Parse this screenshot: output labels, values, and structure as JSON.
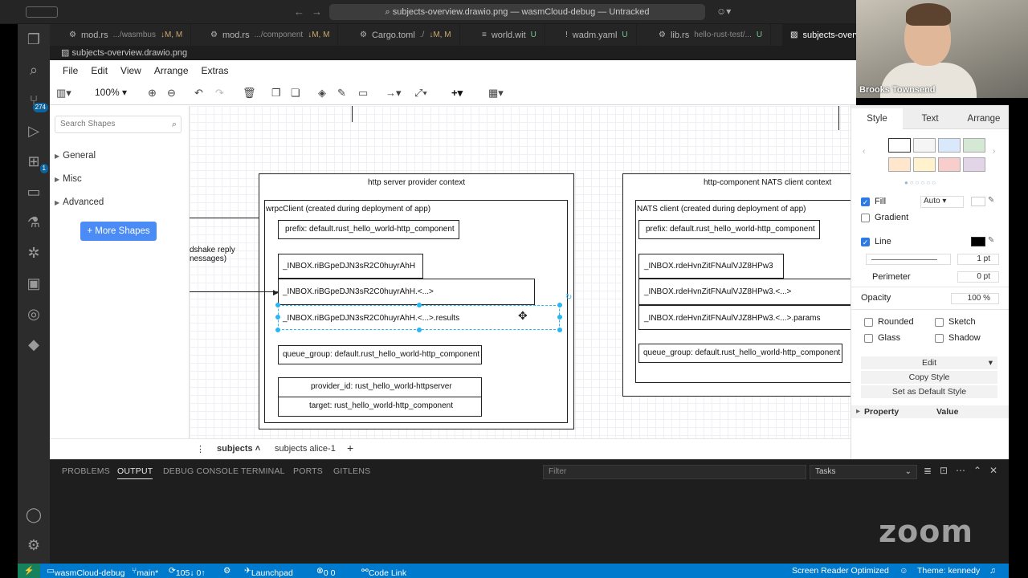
{
  "titlebar": {
    "command_center": "subjects-overview.drawio.png — wasmCloud-debug — Untracked"
  },
  "activity_badges": {
    "source_control": "274",
    "extensions": "1"
  },
  "tabs": [
    {
      "icon": "rust-icon",
      "name": "mod.rs",
      "path": ".../wasmbus",
      "status": "↓M, M"
    },
    {
      "icon": "rust-icon",
      "name": "mod.rs",
      "path": ".../component",
      "status": "↓M, M"
    },
    {
      "icon": "gear-icon",
      "name": "Cargo.toml",
      "path": "./",
      "status": "↓M, M"
    },
    {
      "icon": "file-icon",
      "name": "world.wit",
      "path": "",
      "status": "U"
    },
    {
      "icon": "exclamation-icon",
      "name": "wadm.yaml",
      "path": "",
      "status": "U"
    },
    {
      "icon": "rust-icon",
      "name": "lib.rs",
      "path": "hello-rust-test/...",
      "status": "U"
    },
    {
      "icon": "image-icon",
      "name": "subjects-overv",
      "path": "",
      "status": ""
    }
  ],
  "breadcrumb": "subjects-overview.drawio.png",
  "drawio": {
    "menu": [
      "File",
      "Edit",
      "View",
      "Arrange",
      "Extras"
    ],
    "zoom": "100%",
    "search_placeholder": "Search Shapes",
    "palettes": [
      "General",
      "Misc",
      "Advanced"
    ],
    "more_shapes": "More Shapes",
    "diagram": {
      "left_context_title": "http server provider context",
      "left_client_title": "wrpcClient (created during deployment of app)",
      "left_prefix": "prefix: default.rust_hello_world-http_component",
      "left_inbox": "_INBOX.riBGpeDJN3sR2C0huyrAhH",
      "left_inbox_wild": "_INBOX.riBGpeDJN3sR2C0huyrAhH.<...>",
      "left_inbox_results": "_INBOX.riBGpeDJN3sR2C0huyrAhH.<...>.results",
      "left_queue_group": "queue_group: default.rust_hello_world-http_component",
      "left_provider_id": "provider_id: rust_hello_world-httpserver",
      "left_target": "target: rust_hello_world-http_component",
      "handshake_line1": "dshake reply",
      "handshake_line2": "nessages)",
      "right_context_title": "http-component NATS client context",
      "right_client_title": "NATS client (created during deployment of app)",
      "right_prefix": "prefix: default.rust_hello_world-http_component",
      "right_inbox": "_INBOX.rdeHvnZitFNAulVJZ8HPw3",
      "right_inbox_wild": "_INBOX.rdeHvnZitFNAulVJZ8HPw3.<...>",
      "right_inbox_params": "_INBOX.rdeHvnZitFNAulVJZ8HPw3.<...>.params",
      "right_queue_group": "queue_group: default.rust_hello_world-http_component"
    },
    "pages": [
      "subjects",
      "subjects alice-1"
    ]
  },
  "format_panel": {
    "tabs": [
      "Style",
      "Text",
      "Arrange"
    ],
    "swatches": [
      "#ffffff",
      "#f5f5f5",
      "#dae8fc",
      "#d5e8d4",
      "#ffe6cc",
      "#fff2cc",
      "#f8cecc",
      "#e1d5e7"
    ],
    "fill_label": "Fill",
    "fill_value": "Auto",
    "gradient_label": "Gradient",
    "line_label": "Line",
    "line_width": "1 pt",
    "perimeter_label": "Perimeter",
    "perimeter_value": "0 pt",
    "opacity_label": "Opacity",
    "opacity_value": "100 %",
    "rounded": "Rounded",
    "sketch": "Sketch",
    "glass": "Glass",
    "shadow": "Shadow",
    "edit": "Edit",
    "copy_style": "Copy Style",
    "set_default": "Set as Default Style",
    "property": "Property",
    "value": "Value"
  },
  "panel": {
    "tabs": [
      "PROBLEMS",
      "OUTPUT",
      "DEBUG CONSOLE",
      "TERMINAL",
      "PORTS",
      "GITLENS"
    ],
    "filter_placeholder": "Filter",
    "tasks": "Tasks"
  },
  "zoom_logo": "zoom",
  "webcam_name": "Brooks Townsend",
  "statusbar": {
    "workspace": "wasmCloud-debug",
    "branch": "main*",
    "sync": "105↓ 0↑",
    "launchpad": "Launchpad",
    "problems": "0  0",
    "codelink": "Code Link",
    "screen_reader": "Screen Reader Optimized",
    "theme": "Theme: kennedy"
  }
}
